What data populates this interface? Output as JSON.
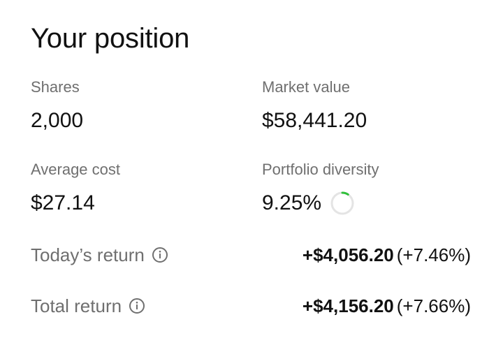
{
  "title": "Your position",
  "stats": {
    "shares": {
      "label": "Shares",
      "value": "2,000"
    },
    "market_value": {
      "label": "Market value",
      "value": "$58,441.20"
    },
    "average_cost": {
      "label": "Average cost",
      "value": "$27.14"
    },
    "portfolio_diversity": {
      "label": "Portfolio diversity",
      "value": "9.25%",
      "fraction": 0.0925
    }
  },
  "returns": {
    "today": {
      "label": "Today’s return",
      "amount": "+$4,056.20",
      "percent": "(+7.46%)",
      "icon": "info-icon"
    },
    "total": {
      "label": "Total return",
      "amount": "+$4,156.20",
      "percent": "(+7.66%)",
      "icon": "info-icon"
    }
  },
  "colors": {
    "text": "#111111",
    "muted": "#6f6f6f",
    "ring_track": "#e4e4e4",
    "ring_fill": "#2fbf3a"
  }
}
